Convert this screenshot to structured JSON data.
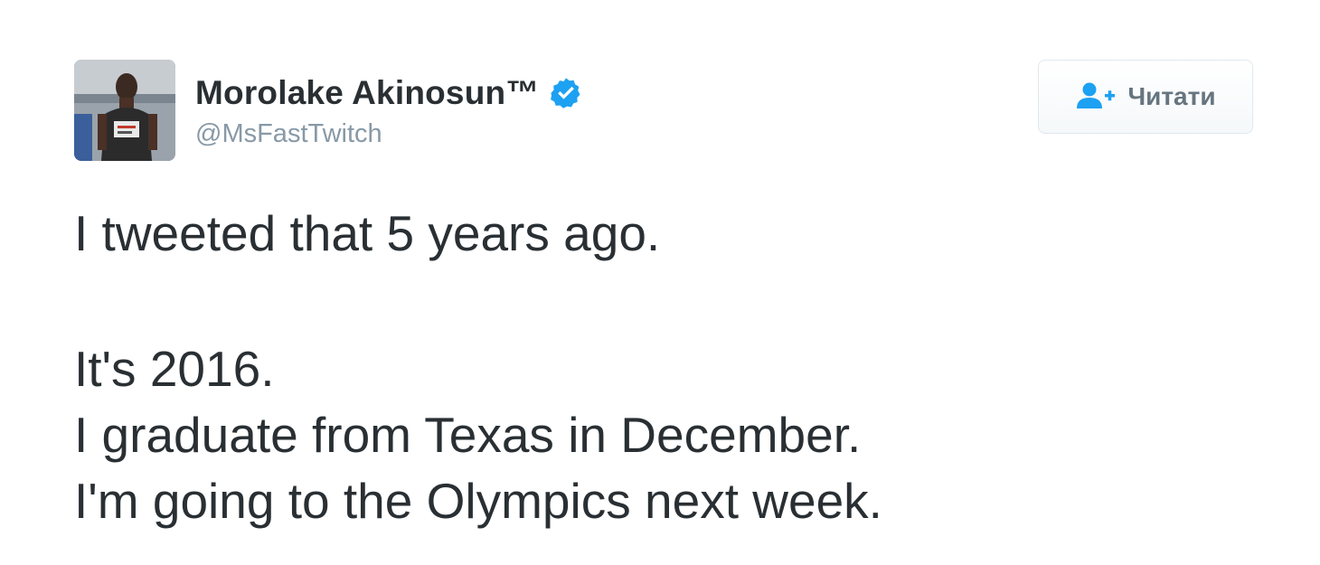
{
  "tweet": {
    "display_name": "Morolake Akinosun™",
    "handle": "@MsFastTwitch",
    "verified_icon": "verified-badge-icon",
    "follow_button": {
      "label": "Читати",
      "icon": "follow-person-plus-icon"
    },
    "lines": [
      "I tweeted that 5 years ago.",
      "It's 2016.",
      "I graduate from Texas in December.",
      "I'm going to the Olympics next week."
    ]
  },
  "colors": {
    "text": "#292f33",
    "muted": "#8899a6",
    "accent": "#1da1f2",
    "button_text": "#66757f"
  }
}
